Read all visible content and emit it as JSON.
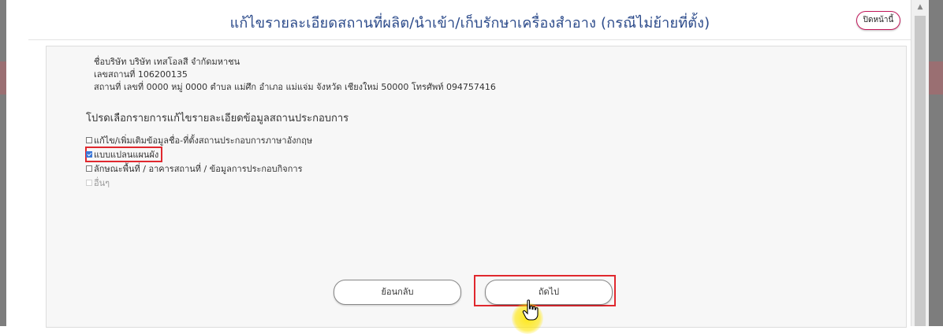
{
  "modal": {
    "title": "แก้ไขรายละเอียดสถานที่ผลิต/นำเข้า/เก็บรักษาเครื่องสำอาง (กรณีไม่ย้ายที่ตั้ง)",
    "close_label": "ปิดหน้านี้"
  },
  "company": {
    "name_line": "ชื่อบริษัท บริษัท เทสโอลสี จำกัดมหาชน",
    "id_line": "เลขสถานที่ 106200135",
    "address_line": "สถานที่ เลขที่ 0000 หมู่ 0000 ตำบล แม่ศึก อำเภอ แม่แจ่ม จังหวัด เชียงใหม่ 50000 โทรศัพท์ 094757416"
  },
  "prompt": "โปรดเลือกรายการแก้ไขรายละเอียดข้อมูลสถานประกอบการ",
  "options": [
    {
      "label": "แก้ไข/เพิ่มเติมข้อมูลชื่อ-ที่ตั้งสถานประกอบการภาษาอังกฤษ",
      "checked": false
    },
    {
      "label": "แบบแปลนแผนผัง",
      "checked": true
    },
    {
      "label": "ลักษณะพื้นที่ / อาคารสถานที่ / ข้อมูลการประกอบกิจการ",
      "checked": false
    },
    {
      "label": "อื่นๆ",
      "checked": false,
      "disabled": true
    }
  ],
  "buttons": {
    "back_label": "ย้อนกลับ",
    "next_label": "ถัดไป"
  },
  "colors": {
    "title": "#2b4a8a",
    "highlight": "#e0282e",
    "checkbox_checked": "#3b78d8"
  }
}
